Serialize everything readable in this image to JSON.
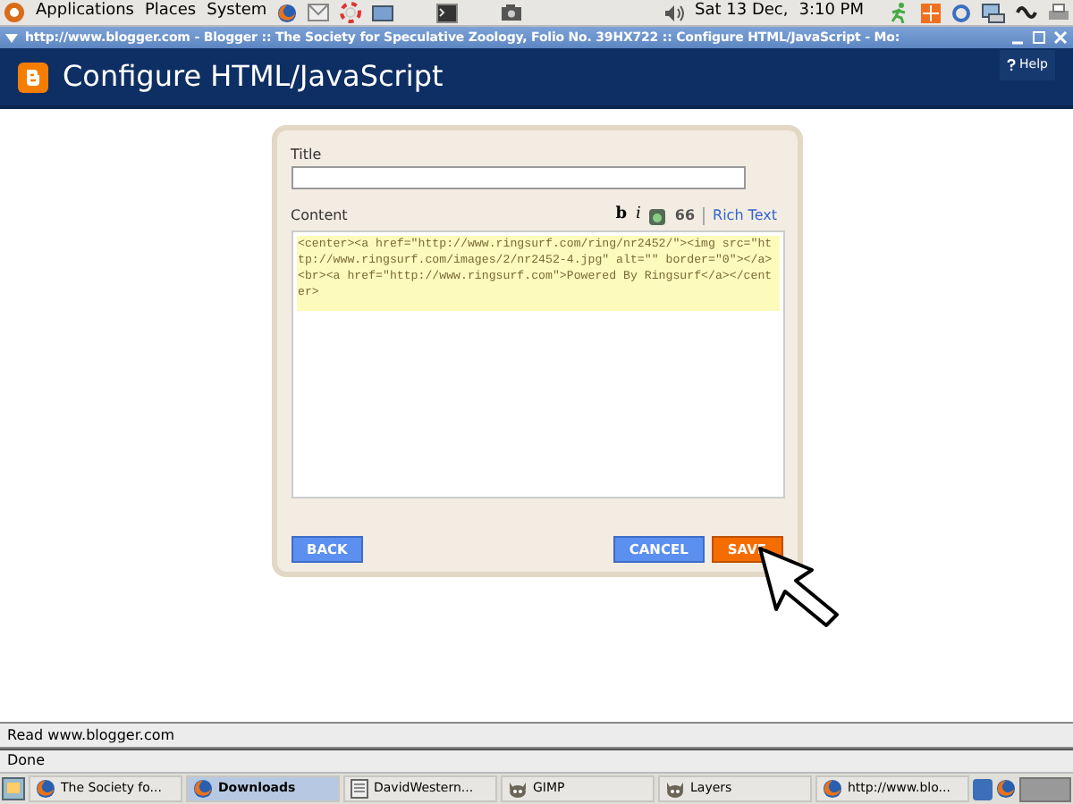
{
  "top_panel": {
    "menus": [
      "Applications",
      "Places",
      "System"
    ],
    "date": "Sat 13 Dec,",
    "time": "3:10 PM"
  },
  "window": {
    "title": "http://www.blogger.com - Blogger :: The Society for Speculative Zoology, Folio No. 39HX722 :: Configure HTML/JavaScript - Mo:"
  },
  "header": {
    "title": "Configure HTML/JavaScript",
    "help": "Help"
  },
  "form": {
    "title_label": "Title",
    "content_label": "Content",
    "toolbar": {
      "bold": "b",
      "italic": "i",
      "quote": "66",
      "rich_text": "Rich Text"
    },
    "content_value": "<center><a href=\"http://www.ringsurf.com/ring/nr2452/\"><img src=\"http://www.ringsurf.com/images/2/nr2452-4.jpg\" alt=\"\" border=\"0\"></a><br><a href=\"http://www.ringsurf.com\">Powered By Ringsurf</a></center>",
    "buttons": [
      {
        "label": "BACK",
        "kind": "secondary"
      },
      {
        "label": "CANCEL",
        "kind": "secondary"
      },
      {
        "label": "SAVE",
        "kind": "primary"
      }
    ]
  },
  "status": {
    "link": "Read www.blogger.com",
    "browser": "Done"
  },
  "taskbar": [
    {
      "label": "The Society fo...",
      "kind": "browser",
      "selected": false
    },
    {
      "label": "Downloads",
      "kind": "browser",
      "selected": true
    },
    {
      "label": "DavidWestern...",
      "kind": "document",
      "selected": false
    },
    {
      "label": "GIMP",
      "kind": "gimp",
      "selected": false
    },
    {
      "label": "Layers",
      "kind": "gimp",
      "selected": false
    },
    {
      "label": "http://www.blo...",
      "kind": "browser",
      "selected": false
    }
  ]
}
